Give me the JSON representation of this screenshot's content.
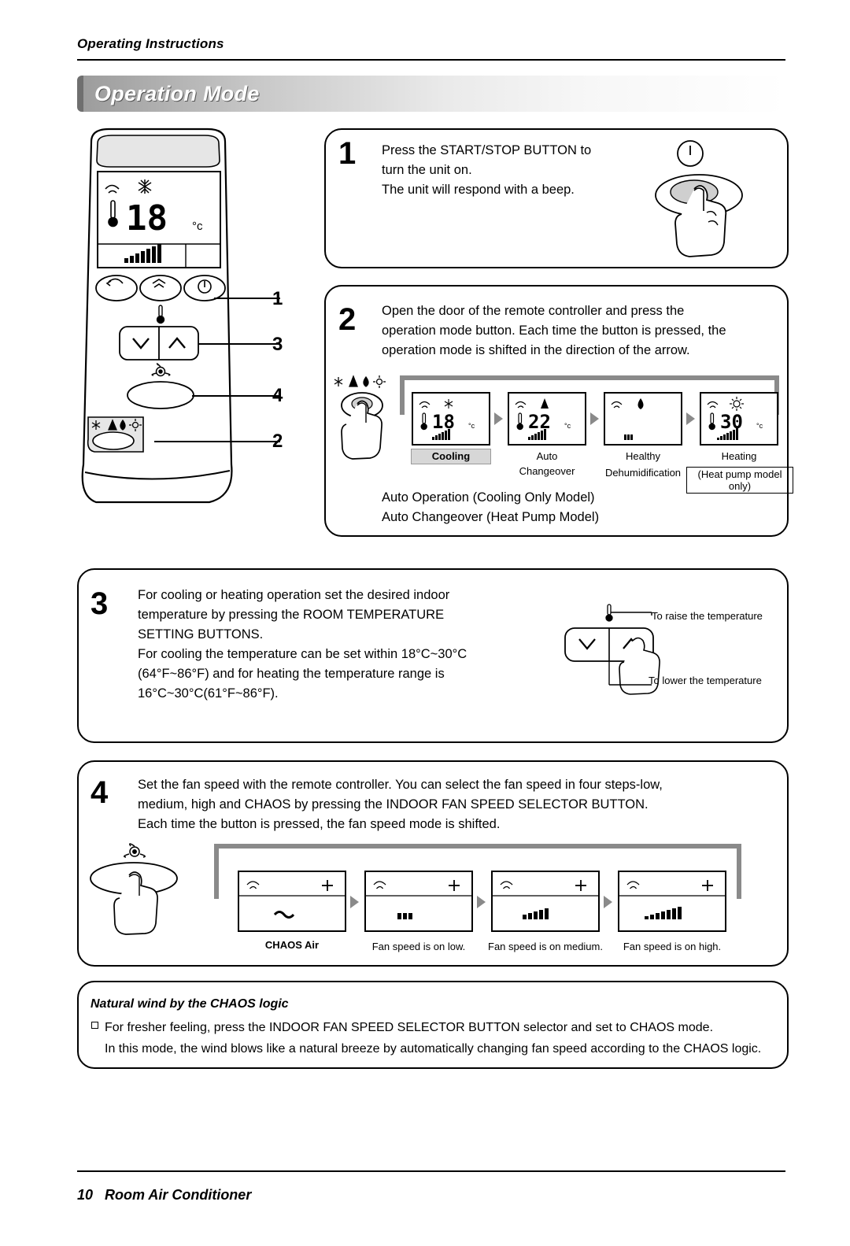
{
  "header": {
    "running_head": "Operating Instructions",
    "title": "Operation Mode"
  },
  "footer": {
    "page_number": "10",
    "product": "Room Air Conditioner"
  },
  "remote_callouts": {
    "c1": "1",
    "c2": "2",
    "c3": "3",
    "c4": "4"
  },
  "remote_display": {
    "temperature": "18",
    "unit": "°C"
  },
  "steps": [
    {
      "number": "1",
      "lines": [
        "Press the START/STOP BUTTON to",
        "turn the unit on.",
        "The unit will respond with a beep."
      ]
    },
    {
      "number": "2",
      "lines": [
        "Open the door of the remote controller and press the",
        "operation mode button. Each time the button is pressed, the",
        "operation mode is shifted in the direction of the arrow."
      ],
      "footnotes": [
        "Auto Operation (Cooling Only Model)",
        "Auto Changeover (Heat Pump Model)"
      ],
      "modes": [
        {
          "temp": "18",
          "unit": "°C",
          "caption1": "Cooling",
          "caption2": "",
          "caption3": "",
          "bars": 6,
          "highlight": true
        },
        {
          "temp": "22",
          "unit": "°C",
          "caption1": "Auto",
          "caption2": "Changeover",
          "caption3": "",
          "bars": 6,
          "highlight": false
        },
        {
          "temp": "",
          "unit": "",
          "caption1": "Healthy",
          "caption2": "Dehumidification",
          "caption3": "",
          "bars": 3,
          "highlight": false
        },
        {
          "temp": "30",
          "unit": "°C",
          "caption1": "Heating",
          "caption2": "(Heat pump model only)",
          "caption3": "",
          "bars": 7,
          "highlight": false
        }
      ]
    },
    {
      "number": "3",
      "lines": [
        "For cooling or heating operation set the desired indoor",
        "temperature by pressing the ROOM TEMPERATURE",
        "SETTING BUTTONS.",
        "For cooling the temperature can be set within 18°C~30°C",
        "(64°F~86°F) and for heating the temperature range is",
        "16°C~30°C(61°F~86°F)."
      ],
      "callout_up": "To raise the temperature",
      "callout_down": "To lower the temperature"
    },
    {
      "number": "4",
      "lines": [
        "Set the fan speed with the remote controller. You can select the fan speed in four steps-low,",
        "medium, high and CHAOS by pressing the INDOOR FAN SPEED SELECTOR BUTTON.",
        "Each time the button is pressed, the fan speed mode is shifted."
      ],
      "fan_modes": [
        {
          "caption": "CHAOS Air",
          "bold": true,
          "bars": 0
        },
        {
          "caption": "Fan speed is on low.",
          "bold": false,
          "bars": 3
        },
        {
          "caption": "Fan speed is on medium.",
          "bold": false,
          "bars": 5
        },
        {
          "caption": "Fan speed is on high.",
          "bold": false,
          "bars": 7
        }
      ]
    }
  ],
  "chaos": {
    "title": "Natural wind by the CHAOS logic",
    "bullet_line": "For fresher feeling, press the INDOOR FAN SPEED SELECTOR BUTTON selector and set to CHAOS mode.",
    "second_line": "In this mode, the wind blows like a natural breeze by automatically changing fan speed according to the CHAOS logic."
  }
}
